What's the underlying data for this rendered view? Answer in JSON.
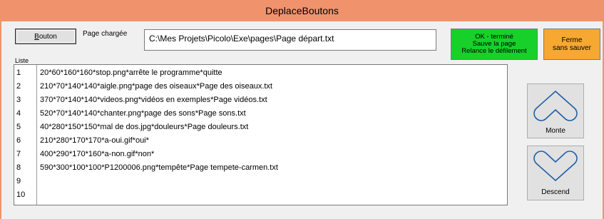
{
  "window": {
    "title": "DeplaceBoutons"
  },
  "toolbar": {
    "bouton_underlined": "B",
    "bouton_rest": "outon",
    "page_label": "Page chargée",
    "page_path": "C:\\Mes Projets\\Picolo\\Exe\\pages\\Page départ.txt",
    "ok_lines": [
      "OK - terminé",
      "Sauve la page",
      "Relance le défilement"
    ],
    "ferme_lines": [
      "Ferme",
      "sans sauver"
    ]
  },
  "list": {
    "label": "Liste",
    "rows": [
      {
        "num": "1",
        "text": "20*60*160*160*stop.png*arrête le programme*quitte"
      },
      {
        "num": "2",
        "text": "210*70*140*140*aigle.png*page des oiseaux*Page des oiseaux.txt"
      },
      {
        "num": "3",
        "text": "370*70*140*140*videos.png*vidéos en exemples*Page vidéos.txt"
      },
      {
        "num": "4",
        "text": "520*70*140*140*chanter.png*page des sons*Page sons.txt"
      },
      {
        "num": "5",
        "text": "40*280*150*150*mal de dos.jpg*douleurs*Page douleurs.txt"
      },
      {
        "num": "6",
        "text": "210*280*170*170*a-oui.gif*oui*"
      },
      {
        "num": "7",
        "text": "400*290*170*160*a-non.gif*non*"
      },
      {
        "num": "8",
        "text": "590*300*100*100*P1200006.png*tempête*Page tempete-carmen.txt"
      },
      {
        "num": "9",
        "text": ""
      },
      {
        "num": "10",
        "text": ""
      }
    ]
  },
  "side": {
    "monte_label": "Monte",
    "descend_label": "Descend"
  },
  "colors": {
    "titlebar": "#f0936d",
    "ok_bg": "#17d12a",
    "ferme_bg": "#f6a833"
  },
  "icons": {
    "monte": "chevron-up-icon",
    "descend": "chevron-down-icon"
  }
}
